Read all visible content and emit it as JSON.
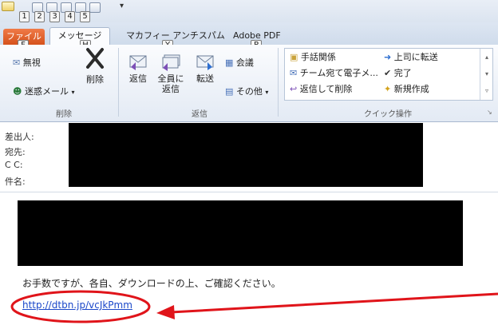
{
  "quick_access": {
    "keytips": [
      "1",
      "2",
      "3",
      "4",
      "5"
    ]
  },
  "tabs": {
    "file": "ファイル",
    "message": "メッセージ",
    "mcafee": "マカフィー アンチスパム",
    "adobe": "Adobe PDF",
    "keytip_file": "F",
    "keytip_message": "H",
    "keytip_mcafee": "Y",
    "keytip_adobe": "P"
  },
  "ribbon": {
    "delete_group": {
      "ignore": "無視",
      "junk": "迷惑メール",
      "delete": "削除",
      "label": "削除"
    },
    "reply_group": {
      "reply": "返信",
      "reply_all_line1": "全員に",
      "reply_all_line2": "返信",
      "forward": "転送",
      "meeting": "会議",
      "more": "その他",
      "label": "返信"
    },
    "quick_steps": {
      "items": [
        "手話関係",
        "上司に転送",
        "チーム宛て電子メ...",
        "完了",
        "返信して削除",
        "新規作成"
      ],
      "label": "クイック操作"
    }
  },
  "header": {
    "from_label": "差出人:",
    "to_label": "宛先:",
    "cc_label": "C C:",
    "subject_label": "件名:"
  },
  "body": {
    "text": "お手数ですが、各自、ダウンロードの上、ご確認ください。",
    "link": "http://dtbn.jp/vcJkPmm"
  },
  "annotation": {
    "color": "#e0141a"
  }
}
